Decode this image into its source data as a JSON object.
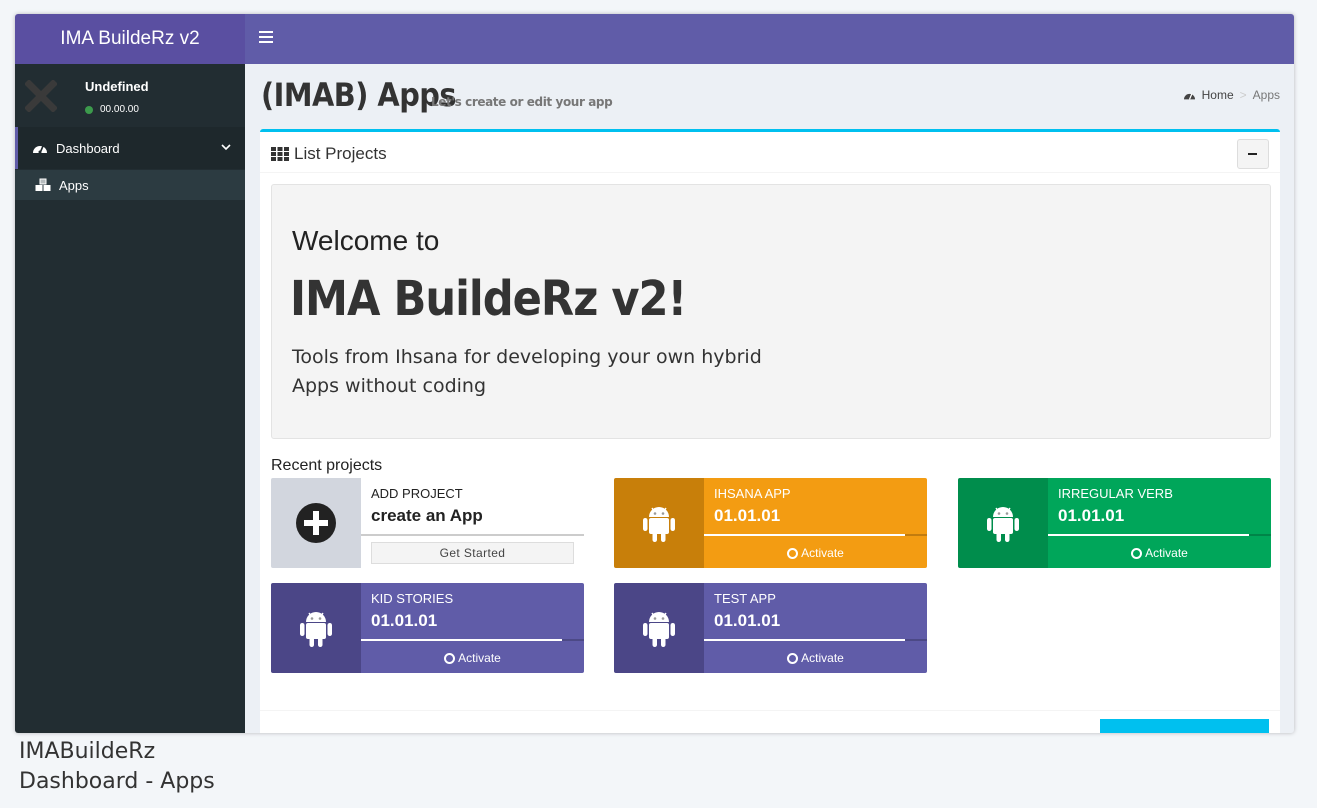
{
  "header": {
    "brand": "IMA BuildeRz v2"
  },
  "user": {
    "name": "Undefined",
    "status": "00.00.00"
  },
  "sidebar": {
    "items": [
      {
        "label": "Dashboard",
        "icon": "dashboard-icon"
      },
      {
        "label": "Apps",
        "icon": "cubes-icon"
      }
    ]
  },
  "page": {
    "title": "(IMAB) Apps",
    "subtitle": "Let's create or edit your app"
  },
  "breadcrumb": {
    "home": "Home",
    "separator": ">",
    "current": "Apps"
  },
  "box": {
    "title": "List Projects"
  },
  "jumbotron": {
    "welcome": "Welcome to",
    "app_name": "IMA BuildeRz v2!",
    "description": "Tools from Ihsana for developing your own hybrid Apps without coding"
  },
  "recent": {
    "label": "Recent projects",
    "add": {
      "label": "ADD PROJECT",
      "title": "create an App",
      "button": "Get Started"
    },
    "projects": [
      {
        "name": "IHSANA APP",
        "version": "01.01.01",
        "action": "Activate",
        "color": "#f39c12",
        "progress": 0.9
      },
      {
        "name": "IRREGULAR VERB",
        "version": "01.01.01",
        "action": "Activate",
        "color": "#00a65a",
        "progress": 0.9
      },
      {
        "name": "KID STORIES",
        "version": "01.01.01",
        "action": "Activate",
        "color": "#605ca8",
        "progress": 0.9
      },
      {
        "name": "TEST APP",
        "version": "01.01.01",
        "action": "Activate",
        "color": "#605ca8",
        "progress": 0.9
      }
    ]
  },
  "caption": {
    "line1": "IMABuildeRz",
    "line2": "Dashboard - Apps"
  },
  "colors": {
    "header": "#605ca8",
    "brand": "#5a4fa1",
    "sidebar": "#222d32",
    "box_accent": "#00c0ef"
  }
}
